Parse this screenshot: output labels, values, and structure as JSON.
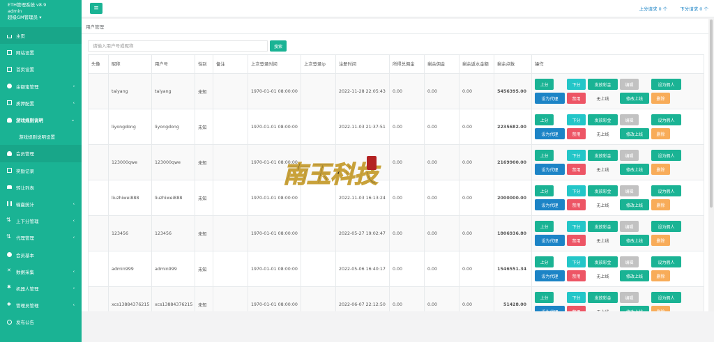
{
  "sidebar": {
    "app_name": "ETH管理系统 v8.9",
    "user": "admin",
    "role": "超级GM管理员 ▾",
    "items": [
      {
        "label": "主页",
        "icon": "home-icon",
        "active": true
      },
      {
        "label": "网站设置",
        "icon": "settings-box-icon"
      },
      {
        "label": "首页设置",
        "icon": "home-settings-icon"
      },
      {
        "label": "余额宝管理",
        "icon": "wallet-icon",
        "arrow": "‹"
      },
      {
        "label": "质押配置",
        "icon": "stake-icon",
        "arrow": "‹"
      },
      {
        "label": "游戏规则说明",
        "icon": "rules-icon",
        "arrow": "⌄",
        "bold": true
      },
      {
        "label": "游戏规则说明设置",
        "sub": true
      },
      {
        "label": "会员管理",
        "icon": "user-icon",
        "active": true
      },
      {
        "label": "奖励记录",
        "icon": "reward-icon"
      },
      {
        "label": "转让列表",
        "icon": "car-icon"
      },
      {
        "label": "输赢统计",
        "icon": "chart-icon",
        "arrow": "‹"
      },
      {
        "label": "上下分管理",
        "icon": "updown-icon",
        "arrow": "‹"
      },
      {
        "label": "代理管理",
        "icon": "agent-icon",
        "arrow": "‹"
      },
      {
        "label": "会员基本",
        "icon": "member-icon"
      },
      {
        "label": "数据采集",
        "icon": "shuffle-icon",
        "arrow": "‹"
      },
      {
        "label": "机器人管理",
        "icon": "robot-icon",
        "arrow": "‹"
      },
      {
        "label": "管理员管理",
        "icon": "admin-icon",
        "arrow": "‹"
      },
      {
        "label": "发布公告",
        "icon": "globe-icon"
      }
    ]
  },
  "topbar": {
    "up_label": "上分请求",
    "up_count": "0 个",
    "down_label": "下分请求",
    "down_count": "0 个"
  },
  "page": {
    "title": "用户管理",
    "search_placeholder": "请输入用户号或昵称",
    "search_button": "搜索"
  },
  "table": {
    "headers": [
      "头像",
      "昵称",
      "用户号",
      "性别",
      "备注",
      "上次登录时间",
      "上次登录ip",
      "注册时间",
      "所得总佣金",
      "剩余佣金",
      "剩余返水金额",
      "剩余点数",
      "操作"
    ],
    "rows": [
      {
        "nick": "taiyang",
        "uid": "taiyang",
        "gender": "未知",
        "last_login": "1970-01-01 08:00:00",
        "ip": "",
        "reg": "2022-11-28 22:05:43",
        "total": "0.00",
        "remain": "0.00",
        "rebate": "0.00",
        "points": "5456395.00"
      },
      {
        "nick": "liyongdong",
        "uid": "liyongdong",
        "gender": "未知",
        "last_login": "1970-01-01 08:00:00",
        "ip": "",
        "reg": "2022-11-03 21:37:51",
        "total": "0.00",
        "remain": "0.00",
        "rebate": "0.00",
        "points": "2235682.00"
      },
      {
        "nick": "123000qwe",
        "uid": "123000qwe",
        "gender": "未知",
        "last_login": "1970-01-01 08:00:00",
        "ip": "",
        "reg": "",
        "total": "0.00",
        "remain": "0.00",
        "rebate": "0.00",
        "points": "2169900.00"
      },
      {
        "nick": "liuzhiwei888",
        "uid": "liuzhiwei888",
        "gender": "未知",
        "last_login": "1970-01-01 08:00:00",
        "ip": "",
        "reg": "2022-11-03 16:13:24",
        "total": "0.00",
        "remain": "0.00",
        "rebate": "0.00",
        "points": "2000000.00"
      },
      {
        "nick": "123456",
        "uid": "123456",
        "gender": "未知",
        "last_login": "1970-01-01 08:00:00",
        "ip": "",
        "reg": "2022-05-27 19:02:47",
        "total": "0.00",
        "remain": "0.00",
        "rebate": "0.00",
        "points": "1806936.80"
      },
      {
        "nick": "admin999",
        "uid": "admin999",
        "gender": "未知",
        "last_login": "1970-01-01 08:00:00",
        "ip": "",
        "reg": "2022-05-06 16:40:17",
        "total": "0.00",
        "remain": "0.00",
        "rebate": "0.00",
        "points": "1546551.34"
      },
      {
        "nick": "xcs13884376215",
        "uid": "xcs13884376215",
        "gender": "未知",
        "last_login": "1970-01-01 08:00:00",
        "ip": "",
        "reg": "2022-06-07 22:12:50",
        "total": "0.00",
        "remain": "0.00",
        "rebate": "0.00",
        "points": "51428.00"
      }
    ],
    "actions": {
      "up": "上分",
      "down": "下分",
      "bonus": "发放彩金",
      "edit": "编辑",
      "set_fake": "设为假人",
      "set_agent": "设为代理",
      "disable": "禁用",
      "online_status": "无上线",
      "edit_parent": "修改上线",
      "delete": "删除"
    }
  },
  "watermark": {
    "text": "南玉科技"
  },
  "colors": {
    "brand": "#1ab394",
    "info": "#23c6c8",
    "blue": "#1c84c6",
    "danger": "#ed5565",
    "warning": "#f8ac59",
    "muted": "#c2c2c2"
  }
}
